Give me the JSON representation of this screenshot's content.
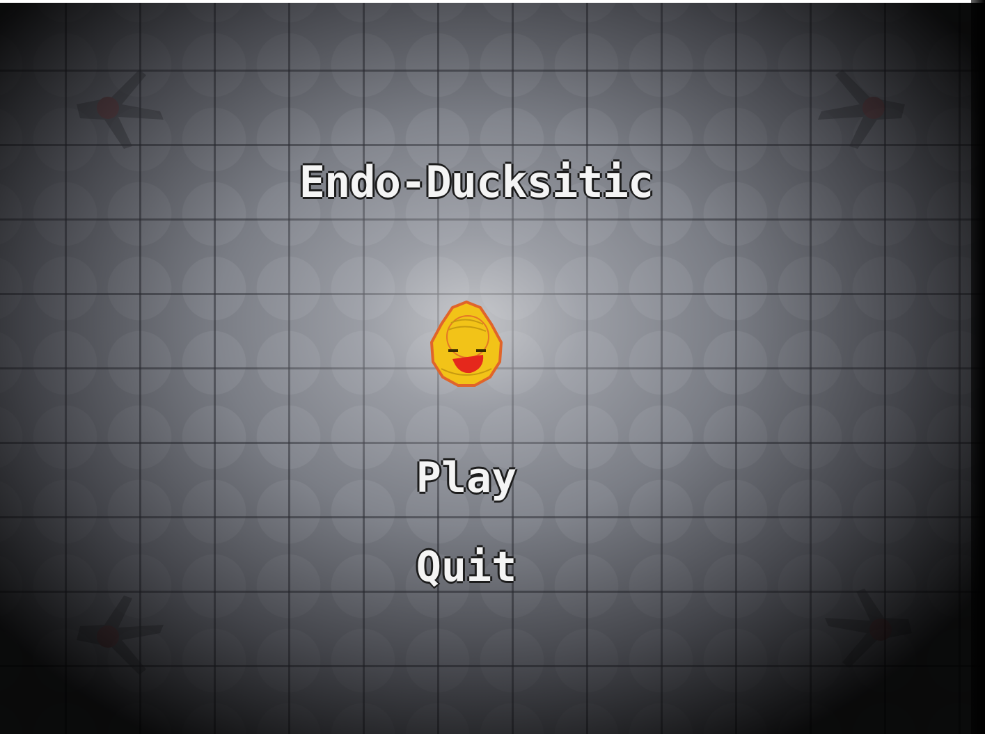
{
  "game": {
    "title": "Endo-Ducksitic",
    "menu": {
      "play_label": "Play",
      "quit_label": "Quit"
    },
    "character": "rubber-duck-icon"
  },
  "colors": {
    "text": "#f4f4f4",
    "text_outline": "#1c1c1c",
    "floor": "#7a7d85",
    "grout": "#282a30",
    "duck_body": "#f2c318",
    "duck_outline": "#e0642a",
    "duck_beak": "#e5281c",
    "decor_blood": "#6a1818"
  }
}
